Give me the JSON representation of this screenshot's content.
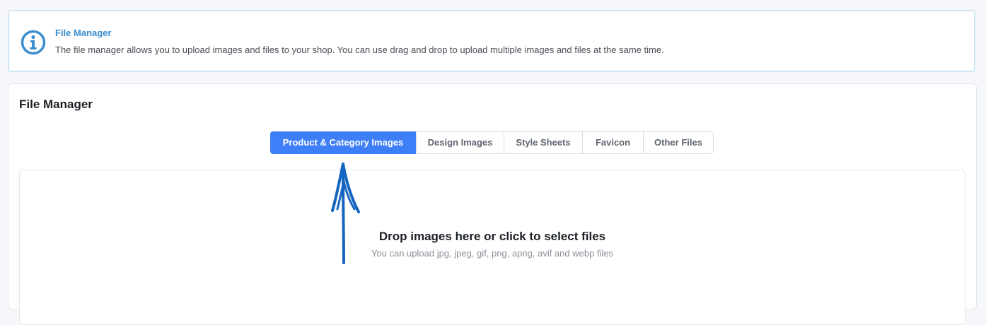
{
  "info": {
    "title": "File Manager",
    "text": "The file manager allows you to upload images and files to your shop. You can use drag and drop to upload multiple images and files at the same time.",
    "icon": "info-icon",
    "color": "#3b8fd1"
  },
  "card": {
    "title": "File Manager"
  },
  "tabs": [
    {
      "label": "Product & Category Images",
      "active": true
    },
    {
      "label": "Design Images",
      "active": false
    },
    {
      "label": "Style Sheets",
      "active": false
    },
    {
      "label": "Favicon",
      "active": false
    },
    {
      "label": "Other Files",
      "active": false
    }
  ],
  "dropzone": {
    "title": "Drop images here or click to select files",
    "subtitle": "You can upload jpg, jpeg, gif, png, apng, avif and webp files"
  },
  "colors": {
    "accent": "#3e7ef7",
    "annotation_arrow": "#1565c0"
  }
}
